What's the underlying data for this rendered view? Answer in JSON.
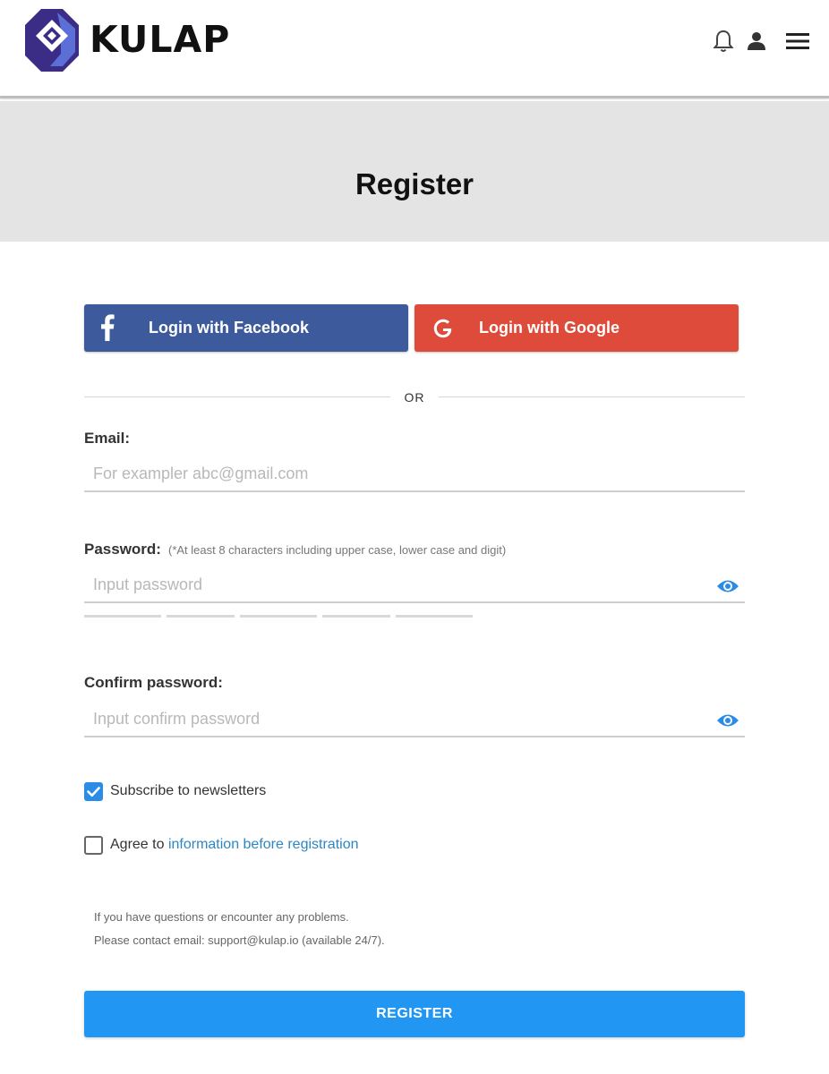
{
  "header": {
    "logo_text": "KULAP",
    "icons": [
      "bell-icon",
      "user-icon",
      "menu-icon"
    ]
  },
  "hero": {
    "title": "Register"
  },
  "social": {
    "facebook_label": "Login with Facebook",
    "google_label": "Login with Google",
    "facebook_color": "#3d5a9c",
    "google_color": "#df4b3b"
  },
  "divider": {
    "text": "OR"
  },
  "form": {
    "email_label": "Email:",
    "email_placeholder": "For exampler abc@gmail.com",
    "email_value": "",
    "password_label": "Password:",
    "password_hint": "(*At least 8 characters including upper case, lower case and digit)",
    "password_placeholder": "Input password",
    "password_value": "",
    "confirm_label": "Confirm password:",
    "confirm_placeholder": "Input confirm password",
    "confirm_value": "",
    "subscribe_label": "Subscribe to newsletters",
    "subscribe_checked": true,
    "agree_prefix": "Agree to",
    "agree_link": "information before registration",
    "agree_checked": false
  },
  "help": {
    "line1": "If you have questions or encounter any problems.",
    "line2": "Please contact email: support@kulap.io (available 24/7)."
  },
  "register_label": "REGISTER",
  "accent_color": "#2196f3"
}
